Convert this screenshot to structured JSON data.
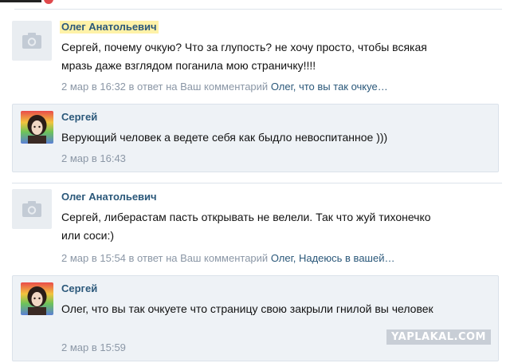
{
  "comments": [
    {
      "author": "Олег Анатольевич",
      "text": "Сергей, почему очкую? Что за глупость? не хочу просто, чтобы всякая мразь даже взглядом поганила мою страничку!!!!",
      "time": "2 мар в 16:32",
      "reply_to": "в ответ на Ваш комментарий",
      "reply_link": "Олег, что вы так очкуе…",
      "reply": {
        "author": "Сергей",
        "text": "Верующий человек а ведете себя как быдло невоспитанное )))",
        "time": "2 мар в 16:43"
      }
    },
    {
      "author": "Олег Анатольевич",
      "text": "Сергей, либерастам пасть открывать не велели. Так что жуй тихонечко или соси:)",
      "time": "2 мар в 15:54",
      "reply_to": "в ответ на Ваш комментарий",
      "reply_link": "Олег, Надеюсь в вашей…",
      "reply": {
        "author": "Сергей",
        "text": "Олег, что вы так очкуете что страницу свою закрыли гнилой вы человек",
        "time": "2 мар в 15:59"
      }
    }
  ],
  "watermark": "YAPLAKAL.COM"
}
